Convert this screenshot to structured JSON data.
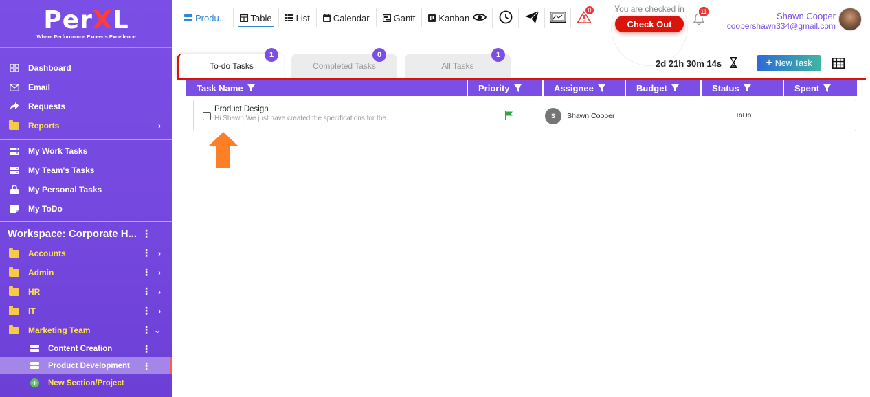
{
  "brand": {
    "logo_main": "Per",
    "logo_x": "X",
    "logo_end": "L",
    "tagline": "Where Performance Exceeds Excellence"
  },
  "sidebar": {
    "main_items": [
      {
        "label": "Dashboard",
        "icon": "dashboard-icon"
      },
      {
        "label": "Email",
        "icon": "email-icon"
      },
      {
        "label": "Requests",
        "icon": "share-icon"
      },
      {
        "label": "Reports",
        "icon": "folder-icon"
      }
    ],
    "task_items": [
      {
        "label": "My Work Tasks",
        "icon": "stack-icon"
      },
      {
        "label": "My Team's Tasks",
        "icon": "stack-icon"
      },
      {
        "label": "My Personal Tasks",
        "icon": "lock-icon"
      },
      {
        "label": "My ToDo",
        "icon": "note-icon"
      }
    ],
    "workspace_title": "Workspace: Corporate H...",
    "folders": [
      {
        "label": "Accounts"
      },
      {
        "label": "Admin"
      },
      {
        "label": "HR"
      },
      {
        "label": "IT"
      },
      {
        "label": "Marketing Team"
      }
    ],
    "sub_items": [
      {
        "label": "Content Creation"
      },
      {
        "label": "Product Development"
      }
    ],
    "new_section": "New Section/Project"
  },
  "topbar": {
    "project_tab": "Produ...",
    "views": [
      "Table",
      "List",
      "Calendar",
      "Gantt",
      "Kanban"
    ],
    "alert_count": "0",
    "checkin_text": "You are checked in",
    "checkout_label": "Check Out",
    "notification_count": "11",
    "user_name": "Shawn Cooper",
    "user_email": "coopershawn334@gmail.com"
  },
  "task_tabs": [
    {
      "label": "To-do Tasks",
      "count": "1"
    },
    {
      "label": "Completed Tasks",
      "count": "0"
    },
    {
      "label": "All Tasks",
      "count": "1"
    }
  ],
  "timer": "2d 21h 30m 14s",
  "new_task_label": "New Task",
  "table": {
    "columns": [
      "Task Name",
      "Priority",
      "Assignee",
      "Budget",
      "Status",
      "Spent"
    ],
    "rows": [
      {
        "title": "Product Design",
        "description": "Hi Shawn,We just have created the specifications for the...",
        "assignee_initial": "S",
        "assignee": "Shawn Cooper",
        "status": "ToDo"
      }
    ]
  },
  "colors": {
    "accent": "#7b4fe6",
    "checkout": "#d9140b",
    "priority_flag": "#2eaa3a",
    "arrow": "#ff7f27"
  }
}
